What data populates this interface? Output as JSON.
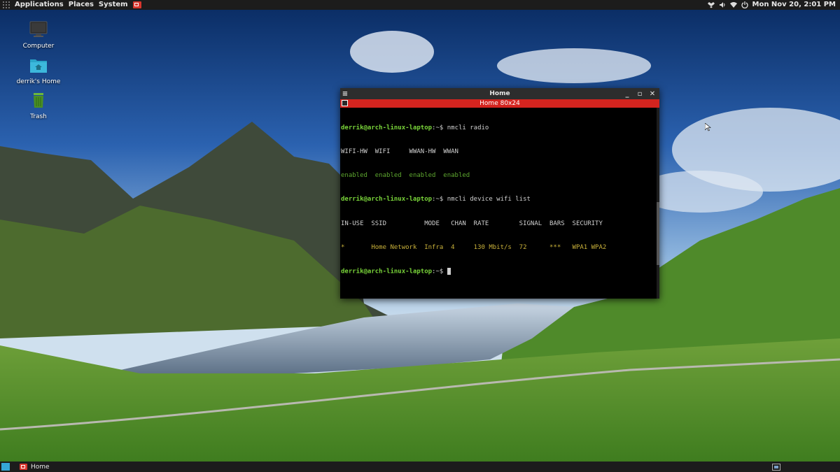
{
  "top_panel": {
    "menus": [
      "Applications",
      "Places",
      "System"
    ],
    "clock": "Mon Nov 20,  2:01 PM",
    "tray_icons": [
      "dropbox-icon",
      "volume-icon",
      "wifi-icon",
      "power-icon"
    ]
  },
  "desktop": {
    "icons": [
      {
        "label": "Computer",
        "icon": "computer-icon"
      },
      {
        "label": "derrik's Home",
        "icon": "home-folder-icon"
      },
      {
        "label": "Trash",
        "icon": "trash-icon"
      }
    ]
  },
  "terminal": {
    "window_title": "Home",
    "tab_title": "Home 80x24",
    "prompt_user": "derrik@arch-linux-laptop",
    "prompt_suffix": ":~$",
    "commands": [
      "nmcli radio",
      "nmcli device wifi list"
    ],
    "radio_header": "WIFI-HW  WIFI     WWAN-HW  WWAN",
    "radio_values": "enabled  enabled  enabled  enabled",
    "wifi_header": "IN-USE  SSID          MODE   CHAN  RATE        SIGNAL  BARS  SECURITY",
    "wifi_row": "*       Home Network  Infra  4     130 Mbit/s  72      ***   WPA1 WPA2"
  },
  "bottom_panel": {
    "task_label": "Home"
  },
  "colors": {
    "panel_bg": "#1c1c1c",
    "tab_accent": "#d4241f",
    "prompt_green": "#7ad53a",
    "wifi_row_yellow": "#c9b13a"
  }
}
